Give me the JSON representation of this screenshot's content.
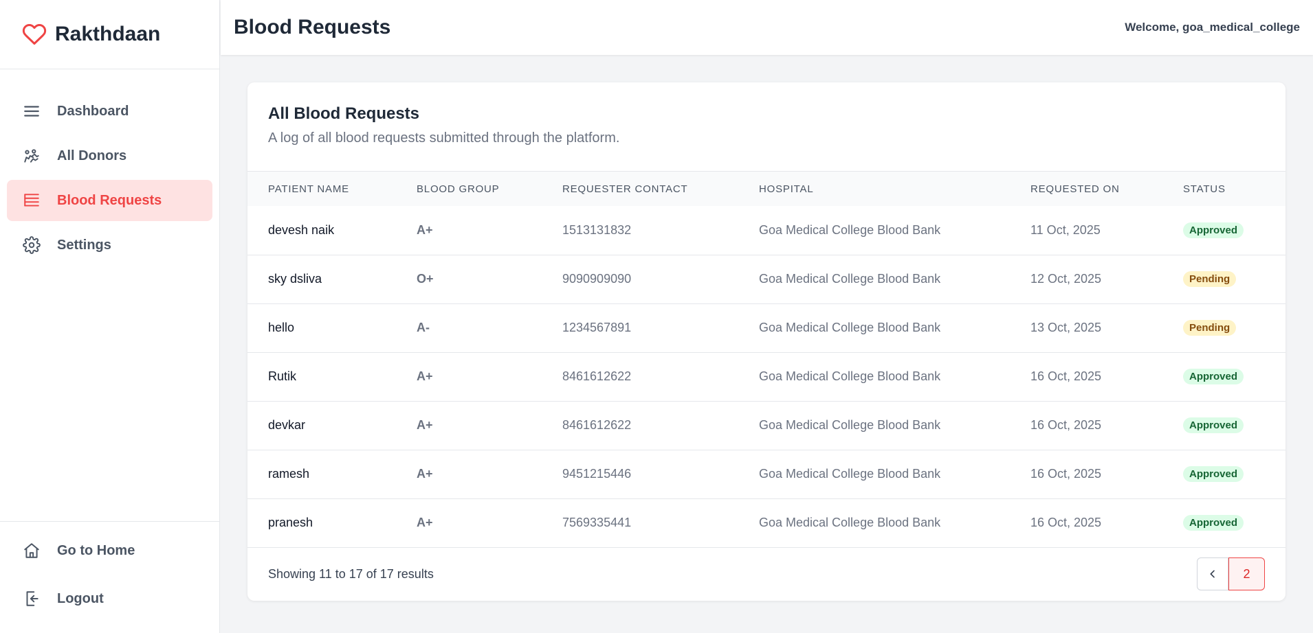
{
  "brand": {
    "name": "Rakthdaan"
  },
  "sidebar": {
    "items": [
      {
        "label": "Dashboard",
        "icon": "menu-icon"
      },
      {
        "label": "All Donors",
        "icon": "donors-icon"
      },
      {
        "label": "Blood Requests",
        "icon": "list-icon",
        "active": true
      },
      {
        "label": "Settings",
        "icon": "gear-icon"
      }
    ],
    "bottom": [
      {
        "label": "Go to Home",
        "icon": "home-icon"
      },
      {
        "label": "Logout",
        "icon": "logout-icon"
      }
    ]
  },
  "header": {
    "title": "Blood Requests",
    "welcome": "Welcome, goa_medical_college"
  },
  "card": {
    "title": "All Blood Requests",
    "subtitle": "A log of all blood requests submitted through the platform."
  },
  "table": {
    "columns": [
      "PATIENT NAME",
      "BLOOD GROUP",
      "REQUESTER CONTACT",
      "HOSPITAL",
      "REQUESTED ON",
      "STATUS"
    ],
    "rows": [
      {
        "patient": "devesh naik",
        "group": "A+",
        "contact": "1513131832",
        "hospital": "Goa Medical College Blood Bank",
        "date": "11 Oct, 2025",
        "status": "Approved"
      },
      {
        "patient": "sky dsliva",
        "group": "O+",
        "contact": "9090909090",
        "hospital": "Goa Medical College Blood Bank",
        "date": "12 Oct, 2025",
        "status": "Pending"
      },
      {
        "patient": "hello",
        "group": "A-",
        "contact": "1234567891",
        "hospital": "Goa Medical College Blood Bank",
        "date": "13 Oct, 2025",
        "status": "Pending"
      },
      {
        "patient": "Rutik",
        "group": "A+",
        "contact": "8461612622",
        "hospital": "Goa Medical College Blood Bank",
        "date": "16 Oct, 2025",
        "status": "Approved"
      },
      {
        "patient": "devkar",
        "group": "A+",
        "contact": "8461612622",
        "hospital": "Goa Medical College Blood Bank",
        "date": "16 Oct, 2025",
        "status": "Approved"
      },
      {
        "patient": "ramesh",
        "group": "A+",
        "contact": "9451215446",
        "hospital": "Goa Medical College Blood Bank",
        "date": "16 Oct, 2025",
        "status": "Approved"
      },
      {
        "patient": "pranesh",
        "group": "A+",
        "contact": "7569335441",
        "hospital": "Goa Medical College Blood Bank",
        "date": "16 Oct, 2025",
        "status": "Approved"
      }
    ]
  },
  "pagination": {
    "summary": "Showing 11 to 17 of 17 results",
    "current_page": "2"
  },
  "colors": {
    "accent": "#ef4444",
    "active_bg": "#fee2e2",
    "approved_bg": "#dcfce7",
    "pending_bg": "#fef3c7"
  }
}
